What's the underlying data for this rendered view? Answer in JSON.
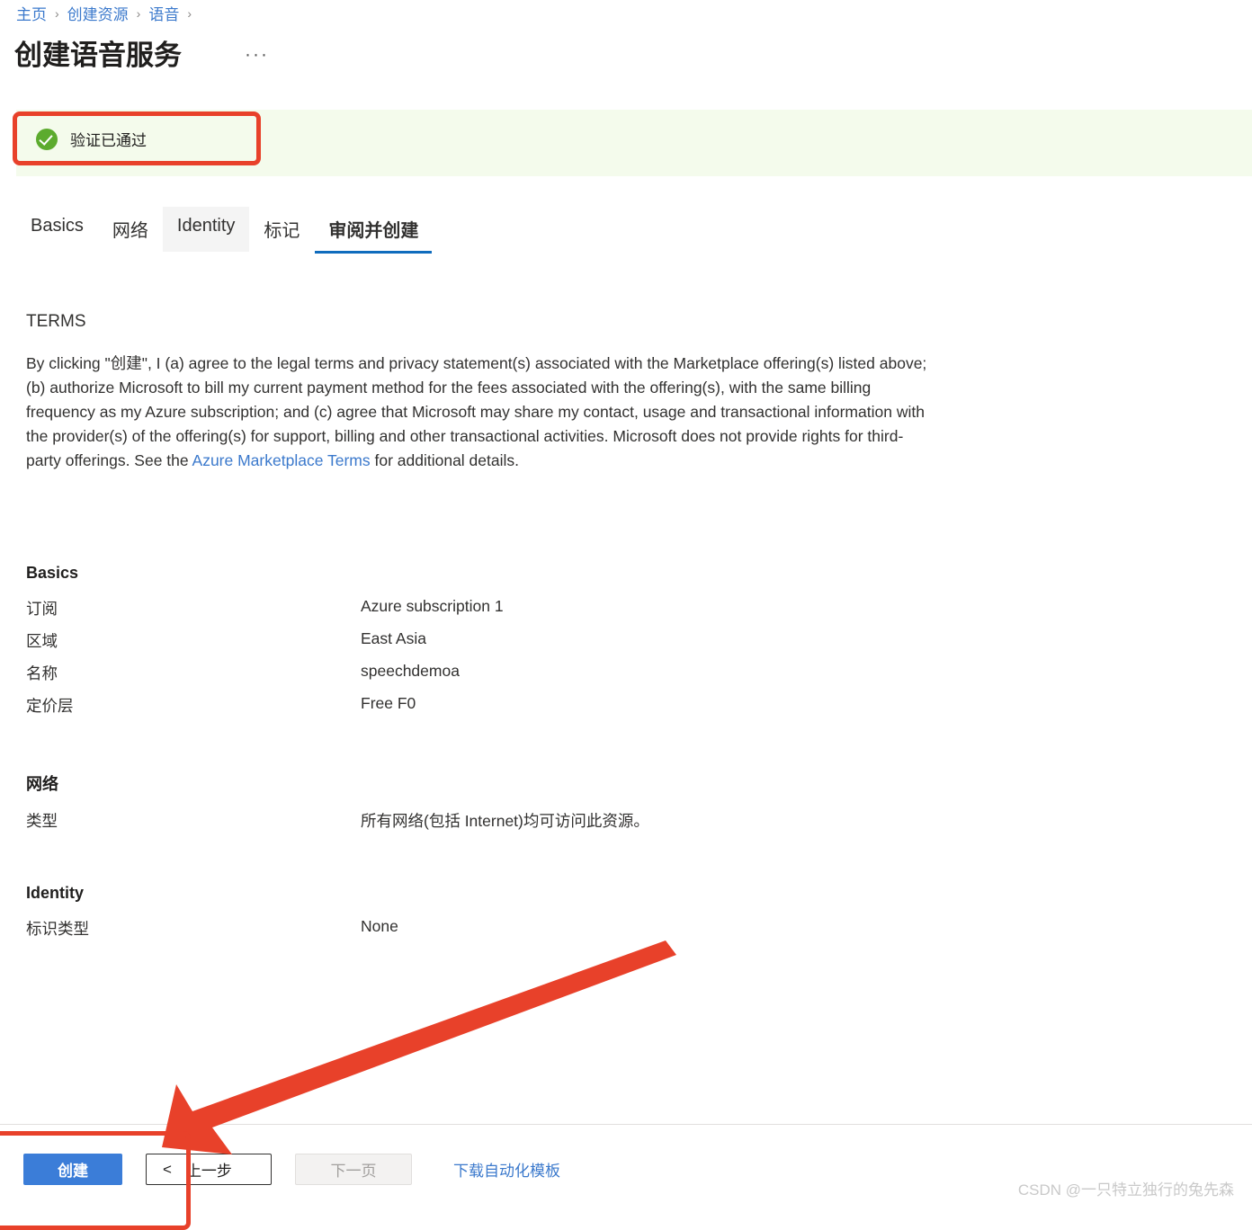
{
  "breadcrumb": {
    "items": [
      "主页",
      "创建资源",
      "语音"
    ],
    "separator": "›",
    "trailing_separator": "›"
  },
  "header": {
    "title": "创建语音服务",
    "ellipsis_menu": "···"
  },
  "validation": {
    "message": "验证已通过",
    "icon": "success-check-icon",
    "background_color": "#f4fbec",
    "icon_color": "#5cab2e"
  },
  "annotations": {
    "highlight_color": "#e8412a",
    "boxes": [
      "validation-banner-highlight",
      "footer-buttons-highlight"
    ],
    "arrow": "arrow-pointing-to-create-button"
  },
  "tabs": [
    {
      "label": "Basics",
      "state": "normal"
    },
    {
      "label": "网络",
      "state": "normal"
    },
    {
      "label": "Identity",
      "state": "hovered"
    },
    {
      "label": "标记",
      "state": "normal"
    },
    {
      "label": "审阅并创建",
      "state": "active"
    }
  ],
  "terms": {
    "heading": "TERMS",
    "paragraph_before_link": "By clicking \"创建\", I (a) agree to the legal terms and privacy statement(s) associated with the Marketplace offering(s) listed above; (b) authorize Microsoft to bill my current payment method for the fees associated with the offering(s), with the same billing frequency as my Azure subscription; and (c) agree that Microsoft may share my contact, usage and transactional information with the provider(s) of the offering(s) for support, billing and other transactional activities. Microsoft does not provide rights for third-party offerings. See the ",
    "link_text": "Azure Marketplace Terms",
    "paragraph_after_link": " for additional details."
  },
  "sections": {
    "basics": {
      "title": "Basics",
      "rows": [
        {
          "key": "订阅",
          "value": "Azure subscription 1"
        },
        {
          "key": "区域",
          "value": "East Asia"
        },
        {
          "key": "名称",
          "value": "speechdemoa"
        },
        {
          "key": "定价层",
          "value": "Free F0"
        }
      ]
    },
    "network": {
      "title": "网络",
      "rows": [
        {
          "key": "类型",
          "value": "所有网络(包括 Internet)均可访问此资源。"
        }
      ]
    },
    "identity": {
      "title": "Identity",
      "rows": [
        {
          "key": "标识类型",
          "value": "None"
        }
      ]
    }
  },
  "footer": {
    "create_label": "创建",
    "previous_arrow": "<",
    "previous_label": "上一步",
    "next_label": "下一页",
    "download_template_label": "下载自动化模板"
  },
  "watermark": {
    "text": "CSDN @一只特立独行的兔先森"
  }
}
